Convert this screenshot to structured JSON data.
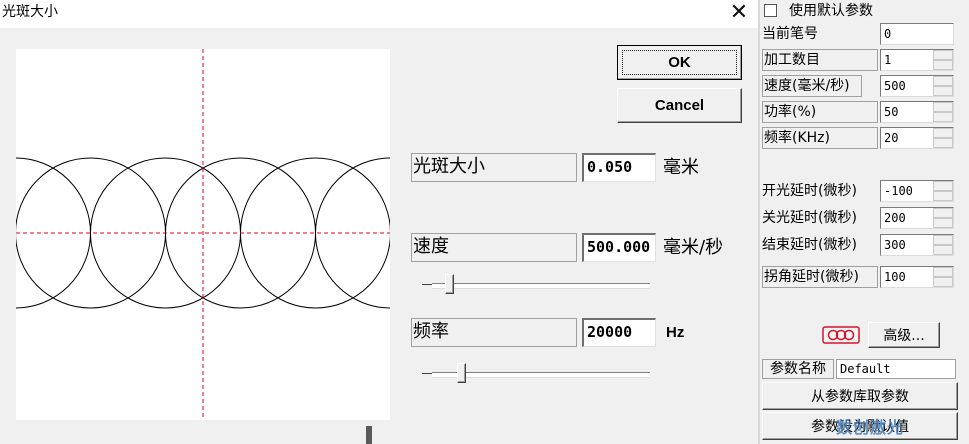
{
  "dialog": {
    "title": "光斑大小",
    "close_glyph": "✕",
    "ok_label": "OK",
    "cancel_label": "Cancel",
    "spot_size": {
      "label": "光斑大小",
      "value": "0.050",
      "unit": "毫米"
    },
    "speed": {
      "label": "速度",
      "value": "500.000",
      "unit": "毫米/秒",
      "slider_fraction": 0.06
    },
    "frequency": {
      "label": "频率",
      "value": "20000",
      "unit": "Hz",
      "slider_fraction": 0.12
    },
    "preview": {
      "crosshair_color": "#e0001a",
      "circle_color": "#000000",
      "circle_count": 6
    }
  },
  "panel": {
    "use_default_label": "使用默认参数",
    "use_default_checked": false,
    "fields": [
      {
        "label": "当前笔号",
        "value": "0",
        "spinner": false
      },
      {
        "label": "加工数目",
        "value": "1",
        "spinner": true
      },
      {
        "label": "速度(毫米/秒)",
        "value": "500",
        "spinner": true
      },
      {
        "label": "功率(%)",
        "value": "50",
        "spinner": true
      },
      {
        "label": "频率(KHz)",
        "value": "20",
        "spinner": true
      },
      {
        "label": "开光延时(微秒)",
        "value": "-100",
        "spinner": true
      },
      {
        "label": "关光延时(微秒)",
        "value": "200",
        "spinner": true
      },
      {
        "label": "结束延时(微秒)",
        "value": "300",
        "spinner": true
      },
      {
        "label": "拐角延时(微秒)",
        "value": "100",
        "spinner": true
      }
    ],
    "advanced_label": "高级...",
    "param_name_label": "参数名称",
    "param_name_value": "Default",
    "load_from_library_label": "从参数库取参数",
    "set_default_label": "参数设为默认值",
    "accent_color": "#d4142a",
    "watermark": "数创激光"
  }
}
